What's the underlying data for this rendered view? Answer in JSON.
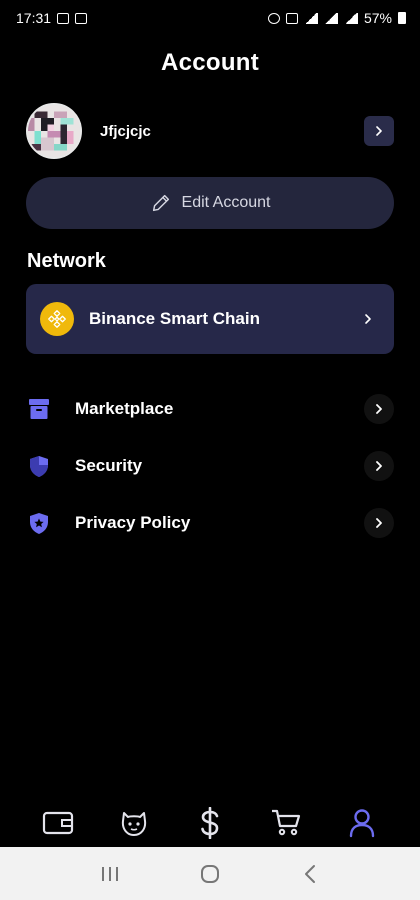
{
  "status_bar": {
    "time": "17:31",
    "battery": "57%"
  },
  "page": {
    "title": "Account"
  },
  "profile": {
    "username": "Jfjcjcjc"
  },
  "edit_button": {
    "label": "Edit Account"
  },
  "network_section": {
    "title": "Network",
    "network_name": "Binance Smart Chain"
  },
  "menu": [
    {
      "label": "Marketplace",
      "icon": "archive-icon"
    },
    {
      "label": "Security",
      "icon": "shield-icon"
    },
    {
      "label": "Privacy Policy",
      "icon": "shield-star-icon"
    }
  ],
  "bottom_nav": {
    "items": [
      "wallet-icon",
      "mascot-icon",
      "dollar-icon",
      "cart-icon",
      "user-icon"
    ],
    "active": "user-icon"
  },
  "colors": {
    "background": "#000000",
    "accent": "#6c6cf0",
    "card": "#262849",
    "bnb": "#f0b90b"
  }
}
